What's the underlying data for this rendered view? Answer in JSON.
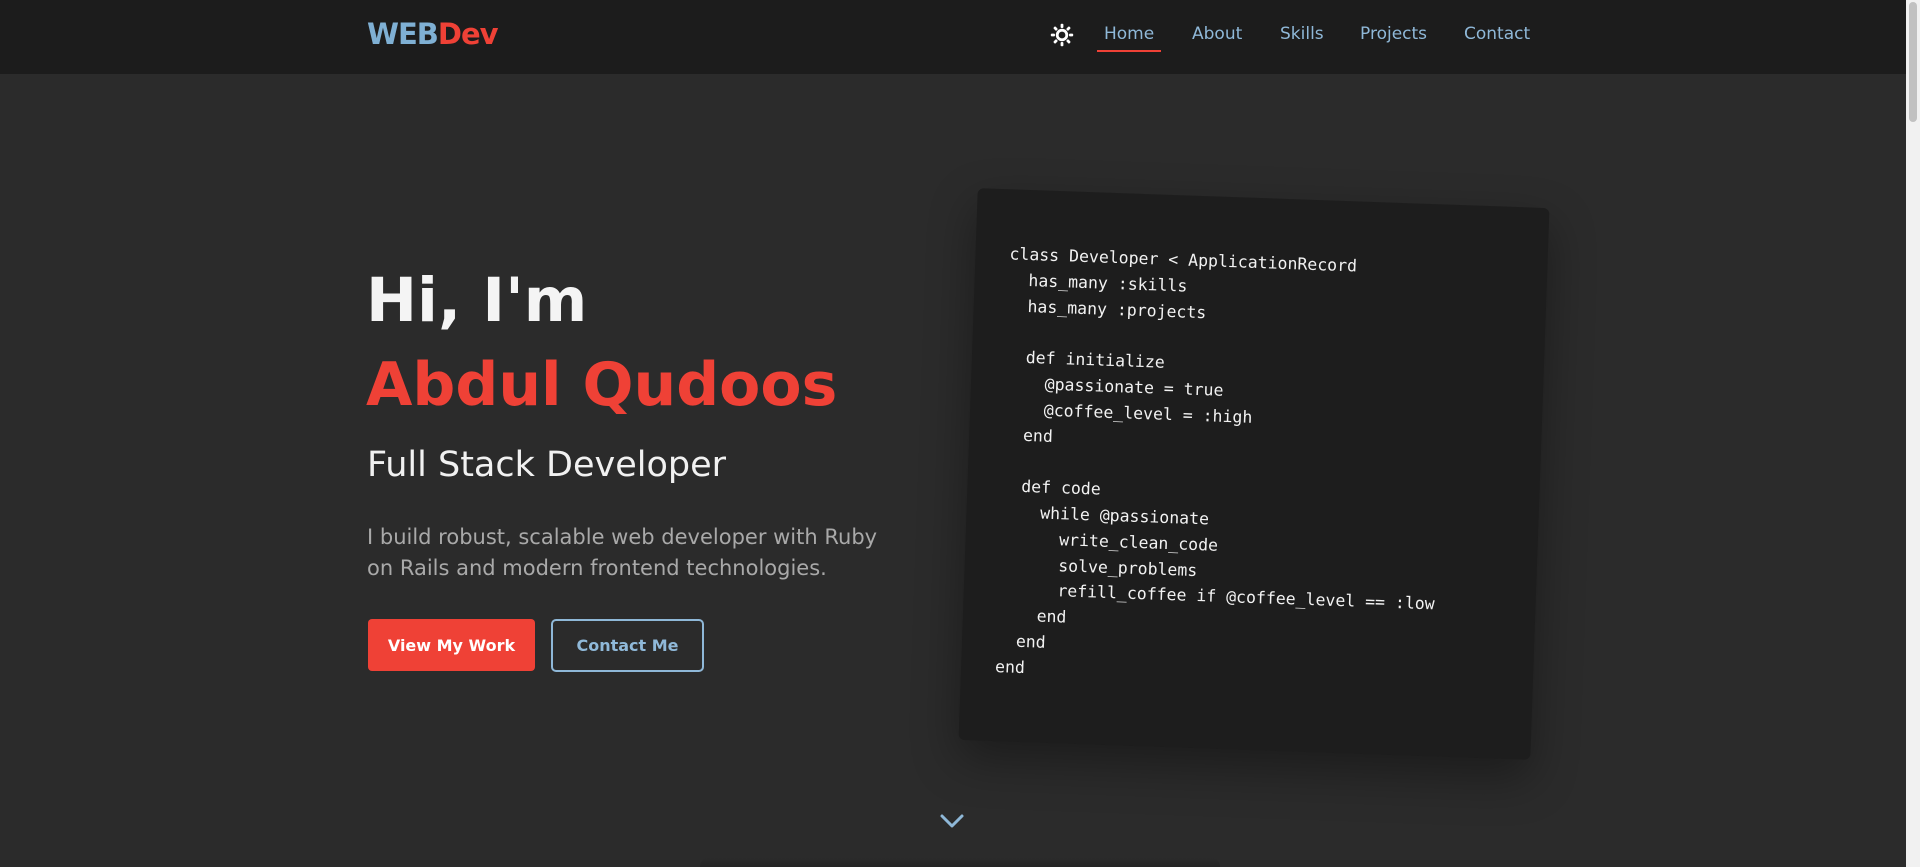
{
  "header": {
    "logo_part1": "WEB",
    "logo_part2": "Dev",
    "theme_icon": "sun-icon",
    "nav": [
      {
        "label": "Home",
        "active": true
      },
      {
        "label": "About",
        "active": false
      },
      {
        "label": "Skills",
        "active": false
      },
      {
        "label": "Projects",
        "active": false
      },
      {
        "label": "Contact",
        "active": false
      }
    ]
  },
  "hero": {
    "greeting": "Hi, I'm",
    "name": "Abdul Qudoos",
    "role": "Full Stack Developer",
    "description": "I build robust, scalable web developer with Ruby on Rails and modern frontend technologies.",
    "primary_button": "View My Work",
    "secondary_button": "Contact Me"
  },
  "code_card": {
    "code": "class Developer < ApplicationRecord\n  has_many :skills\n  has_many :projects\n\n  def initialize\n    @passionate = true\n    @coffee_level = :high\n  end\n\n  def code\n    while @passionate\n      write_clean_code\n      solve_problems\n      refill_coffee if @coffee_level == :low\n    end\n  end\nend"
  },
  "scroll_indicator": {
    "icon": "chevron-down-icon"
  },
  "colors": {
    "accent": "#ef4136",
    "link": "#8fb8d8",
    "logo_blue": "#7fb0d4",
    "background": "#2b2b2b",
    "navbar": "#1c1c1c",
    "code_card": "#1d1d1d"
  }
}
